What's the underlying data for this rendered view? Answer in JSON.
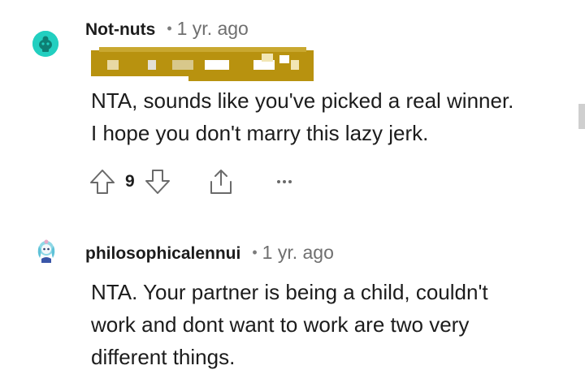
{
  "comments": [
    {
      "username": "Not-nuts",
      "separator": "•",
      "time": "1 yr. ago",
      "flair_text": "...l Curr...",
      "body_lines": [
        "NTA, sounds like you've picked a real winner.",
        "I hope you don't marry this lazy jerk."
      ],
      "votes": "9",
      "icons": [
        "upvote-icon",
        "downvote-icon",
        "share-icon",
        "more-icon"
      ]
    },
    {
      "username": "philosophicalennui",
      "separator": "•",
      "time": "1 yr. ago",
      "body_lines": [
        "NTA. Your partner is being a child, couldn't",
        "work and dont want to work are two very",
        "different things."
      ]
    }
  ],
  "colors": {
    "avatar_1": "#22cfc0",
    "flair_bg": "#b8920f",
    "meta_gray": "#6f6f6f"
  }
}
